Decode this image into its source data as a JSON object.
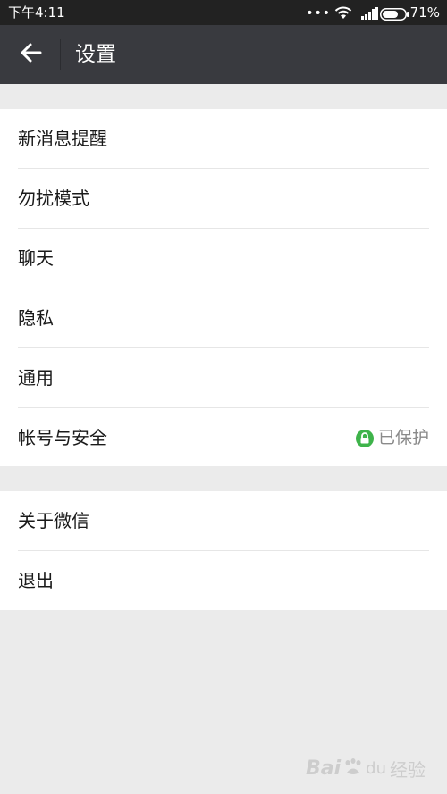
{
  "status_bar": {
    "time": "下午4:11",
    "dots": "•••",
    "battery_percent": "71%",
    "battery_level": 0.71
  },
  "app_bar": {
    "title": "设置",
    "background": "#393a3f"
  },
  "settings": {
    "group1": [
      {
        "label": "新消息提醒"
      },
      {
        "label": "勿扰模式"
      },
      {
        "label": "聊天"
      },
      {
        "label": "隐私"
      },
      {
        "label": "通用"
      },
      {
        "label": "帐号与安全",
        "status": "已保护",
        "status_icon": "lock-icon",
        "status_color": "#3eb34a"
      }
    ],
    "group2": [
      {
        "label": "关于微信"
      },
      {
        "label": "退出"
      }
    ]
  },
  "watermark": {
    "bai": "Bai",
    "du": "du",
    "jingyan": "经验"
  }
}
